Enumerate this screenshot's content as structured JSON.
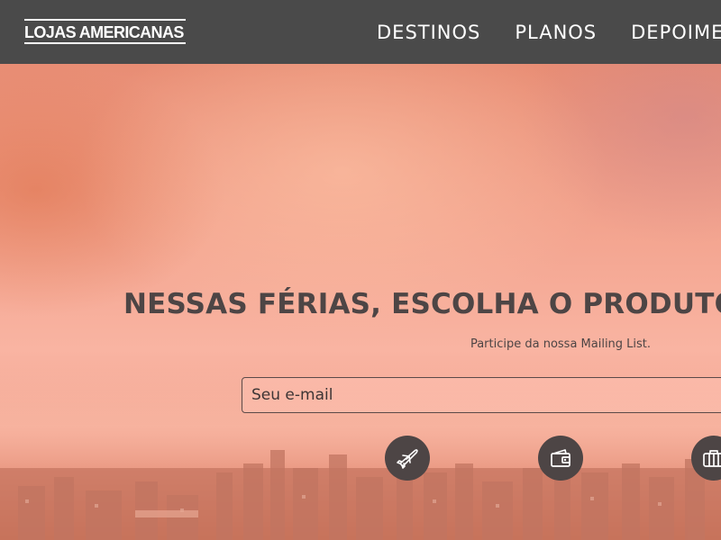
{
  "header": {
    "logo_text": "LOJAS AMERICANAS",
    "nav": [
      {
        "label": "DESTINOS"
      },
      {
        "label": "PLANOS"
      },
      {
        "label": "DEPOIMENTOS"
      }
    ]
  },
  "hero": {
    "headline": "NESSAS FÉRIAS, ESCOLHA O PRODUTO CERTO",
    "subtitle": "Participe da nossa Mailing List.",
    "email_placeholder": "Seu e-mail"
  },
  "features": [
    {
      "icon": "airplane-icon"
    },
    {
      "icon": "wallet-icon"
    },
    {
      "icon": "suitcase-icon"
    }
  ],
  "colors": {
    "navbar": "#4a4a4a",
    "text_dark": "#4d4545",
    "icon_circle": "#4d4545",
    "hero_tint": "#f4a690"
  }
}
